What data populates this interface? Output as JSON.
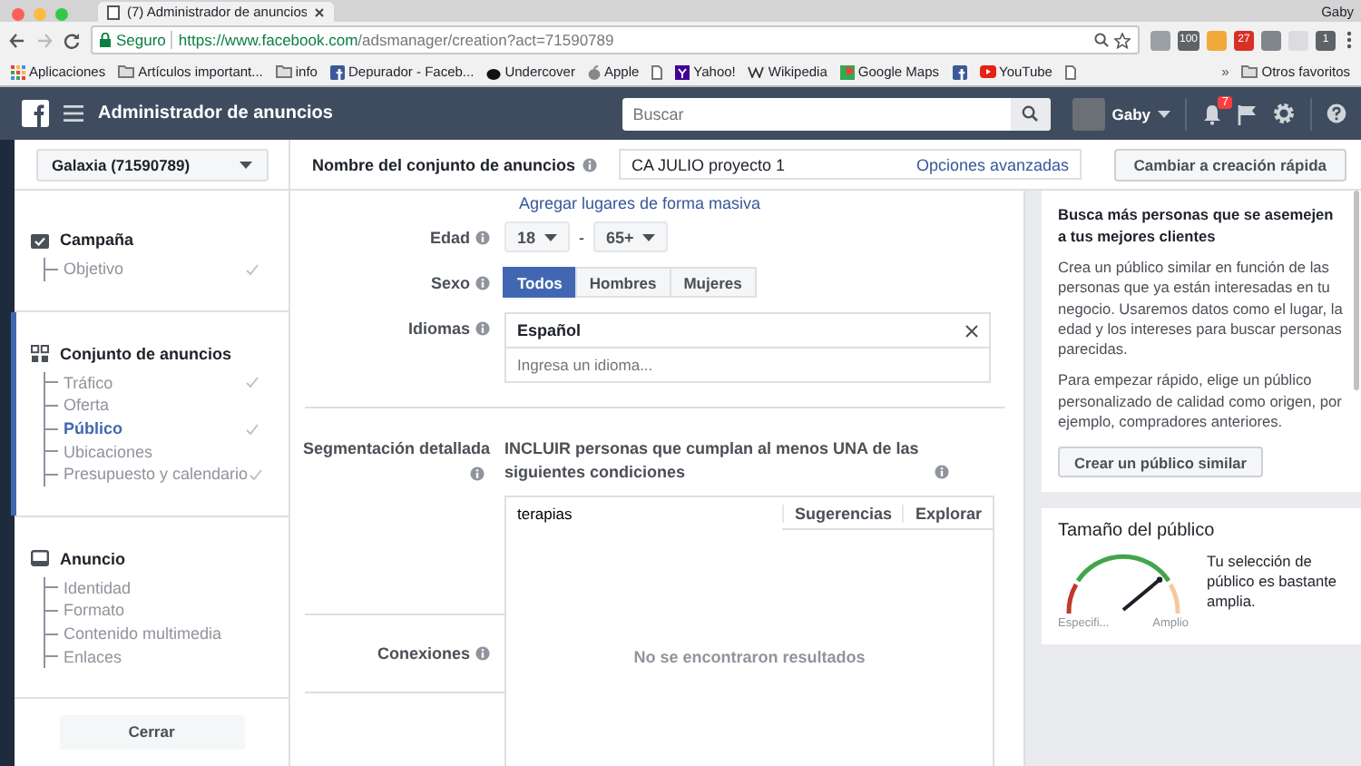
{
  "browser": {
    "tab_title": "(7) Administrador de anuncios",
    "user": "Gaby",
    "secure_label": "Seguro",
    "url_host": "https://www.facebook.com",
    "url_path": "/adsmanager/creation?act=71590789",
    "extensions": [
      {
        "kind": "tray"
      },
      {
        "kind": "label",
        "label": "100"
      },
      {
        "kind": "sun"
      },
      {
        "kind": "calendar",
        "label": "27"
      },
      {
        "kind": "circle"
      },
      {
        "kind": "pill"
      },
      {
        "kind": "label",
        "label": "1"
      }
    ],
    "bookmarks": [
      {
        "kind": "apps",
        "label": "Aplicaciones"
      },
      {
        "kind": "folder",
        "label": "Artículos important..."
      },
      {
        "kind": "folder",
        "label": "info"
      },
      {
        "kind": "square",
        "label": "Depurador - Faceb..."
      },
      {
        "kind": "dark",
        "label": "Undercover"
      },
      {
        "kind": "apple",
        "label": "Apple"
      },
      {
        "kind": "page"
      },
      {
        "kind": "purple",
        "label": "Yahoo!"
      },
      {
        "kind": "w",
        "label": "Wikipedia"
      },
      {
        "kind": "map",
        "label": "Google Maps"
      },
      {
        "kind": "square"
      },
      {
        "kind": "play",
        "label": "YouTube"
      },
      {
        "kind": "page"
      }
    ],
    "overflow": "»",
    "other_bookmarks": "Otros favoritos"
  },
  "header": {
    "title": "Administrador de anuncios",
    "search": {
      "placeholder": "Buscar"
    },
    "user": "Gaby",
    "notifications": "7"
  },
  "subheader": {
    "account": "Galaxia (71590789)",
    "name_label": "Nombre del conjunto de anuncios",
    "name_value": "CA JULIO proyecto 1",
    "advanced_link": "Opciones avanzadas",
    "quick_button": "Cambiar a creación rápida"
  },
  "sidebar": {
    "sections": [
      {
        "kind": "campaign",
        "title": "Campaña",
        "active": false,
        "items": [
          {
            "label": "Objetivo",
            "done": true,
            "selected": false
          }
        ]
      },
      {
        "kind": "adset",
        "title": "Conjunto de anuncios",
        "active": true,
        "items": [
          {
            "label": "Tráfico",
            "done": true,
            "selected": false
          },
          {
            "label": "Oferta",
            "done": false,
            "selected": false
          },
          {
            "label": "Público",
            "done": true,
            "selected": true
          },
          {
            "label": "Ubicaciones",
            "done": false,
            "selected": false
          },
          {
            "label": "Presupuesto y calendario",
            "done": true,
            "selected": false
          }
        ]
      },
      {
        "kind": "ad",
        "title": "Anuncio",
        "active": false,
        "items": [
          {
            "label": "Identidad",
            "done": false,
            "selected": false
          },
          {
            "label": "Formato",
            "done": false,
            "selected": false
          },
          {
            "label": "Contenido multimedia",
            "done": false,
            "selected": false
          },
          {
            "label": "Enlaces",
            "done": false,
            "selected": false
          }
        ]
      }
    ],
    "close_button": "Cerrar"
  },
  "form": {
    "bulk_link": "Agregar lugares de forma masiva",
    "age": {
      "label": "Edad",
      "min": "18",
      "separator": "-",
      "max": "65+"
    },
    "gender": {
      "label": "Sexo",
      "options": [
        {
          "label": "Todos",
          "selected": true
        },
        {
          "label": "Hombres",
          "selected": false
        },
        {
          "label": "Mujeres",
          "selected": false
        }
      ]
    },
    "languages": {
      "label": "Idiomas",
      "tokens": [
        "Español"
      ],
      "placeholder": "Ingresa un idioma..."
    },
    "detailed": {
      "label": "Segmentación detallada",
      "heading": "INCLUIR personas que cumplan al menos UNA de las siguientes condiciones",
      "value": "terapias",
      "links": [
        "Sugerencias",
        "Explorar"
      ],
      "empty": "No se encontraron resultados"
    },
    "connections": {
      "label": "Conexiones"
    }
  },
  "right": {
    "lookalike": {
      "title": "Busca más personas que se asemejen a tus mejores clientes",
      "paragraphs": [
        "Crea un público similar en función de las personas que ya están interesadas en tu negocio. Usaremos datos como el lugar, la edad y los intereses para buscar personas parecidas.",
        "Para empezar rápido, elige un público personalizado de calidad como origen, por ejemplo, compradores anteriores."
      ],
      "button": "Crear un público similar"
    },
    "audience": {
      "title": "Tamaño del público",
      "level": 0.78,
      "min_label": "Especifi...",
      "max_label": "Amplio",
      "description": "Tu selección de público es bastante amplia."
    }
  }
}
